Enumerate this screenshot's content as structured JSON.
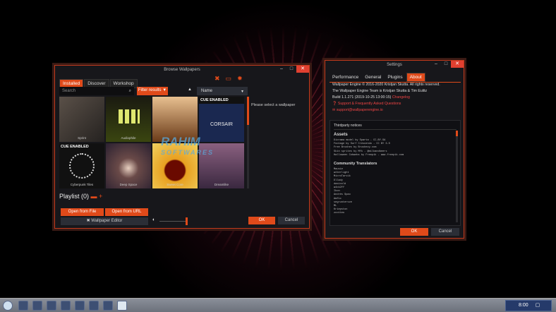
{
  "browse": {
    "title": "Browse Wallpapers",
    "tabs": [
      "Installed",
      "Discover",
      "Workshop"
    ],
    "search_placeholder": "Search",
    "filter_label": "Filter results",
    "sort_value": "Name",
    "hint": "Please select a wallpaper",
    "tiles": [
      {
        "name": "Sprint",
        "bg": "#3a3530"
      },
      {
        "name": "Audiophile",
        "bg": "#2a3010"
      },
      {
        "name": "",
        "bg": "#6a4020"
      },
      {
        "name": "",
        "bg": "#1a2850",
        "badge": "CUE ENABLED",
        "brand": "CORSAIR"
      },
      {
        "name": "Cyberpunk Tiles",
        "bg": "#111",
        "badge": "CUE ENABLED"
      },
      {
        "name": "Deep Space",
        "bg": "#5a4040"
      },
      {
        "name": "Sweet Core",
        "bg": "#c07010"
      },
      {
        "name": "Dreamlike",
        "bg": "#6a4a70"
      }
    ],
    "playlist_label": "Playlist (0)",
    "open_file": "Open from File",
    "open_url": "Open from URL",
    "editor": "Wallpaper Editor",
    "ok": "OK",
    "cancel": "Cancel"
  },
  "watermark": {
    "line1": "RAHIM",
    "line2": "SOFTWARES"
  },
  "settings": {
    "title": "Settings",
    "tabs": [
      "Performance",
      "General",
      "Plugins",
      "About"
    ],
    "copyright": "Wallpaper Engine © 2016-2020 Kristjan Skutta. All rights reserved.",
    "team": "The Wallpaper Engine Team is Kristjan Skutta & Tim Eulitz",
    "build": "Build 1.1.271 (2019-10-25 13:00:15)",
    "changelog": "Changelog",
    "faq": "Support & Frequently Asked Questions",
    "email": "support@wallpaperengine.io",
    "third_party": "Thirdparty notices",
    "assets_heading": "Assets",
    "assets": [
      "Diorama model by Sparta - CC-BY-SA",
      "Footage by Surf Crescendo - CC BY 3.0",
      "Free Brushes by Brushezy.com",
      "Skin sprites by Mfk - @milkandbeers",
      "Halloween Cobwebs by Freepik - www.freepik.com"
    ],
    "translators_heading": "Community Translators",
    "translators": [
      "Mausie",
      "w4terlight",
      "MicroTarvik",
      "Dllady",
      "dasicold",
      "w4ck2ff",
      "Ikon",
      "Andrés Spao",
      "Amfix",
      "segruntersze",
      "ML",
      "Kriepston",
      "zcotteo"
    ],
    "ok": "OK",
    "cancel": "Cancel"
  },
  "taskbar": {
    "clock": "8:00"
  }
}
